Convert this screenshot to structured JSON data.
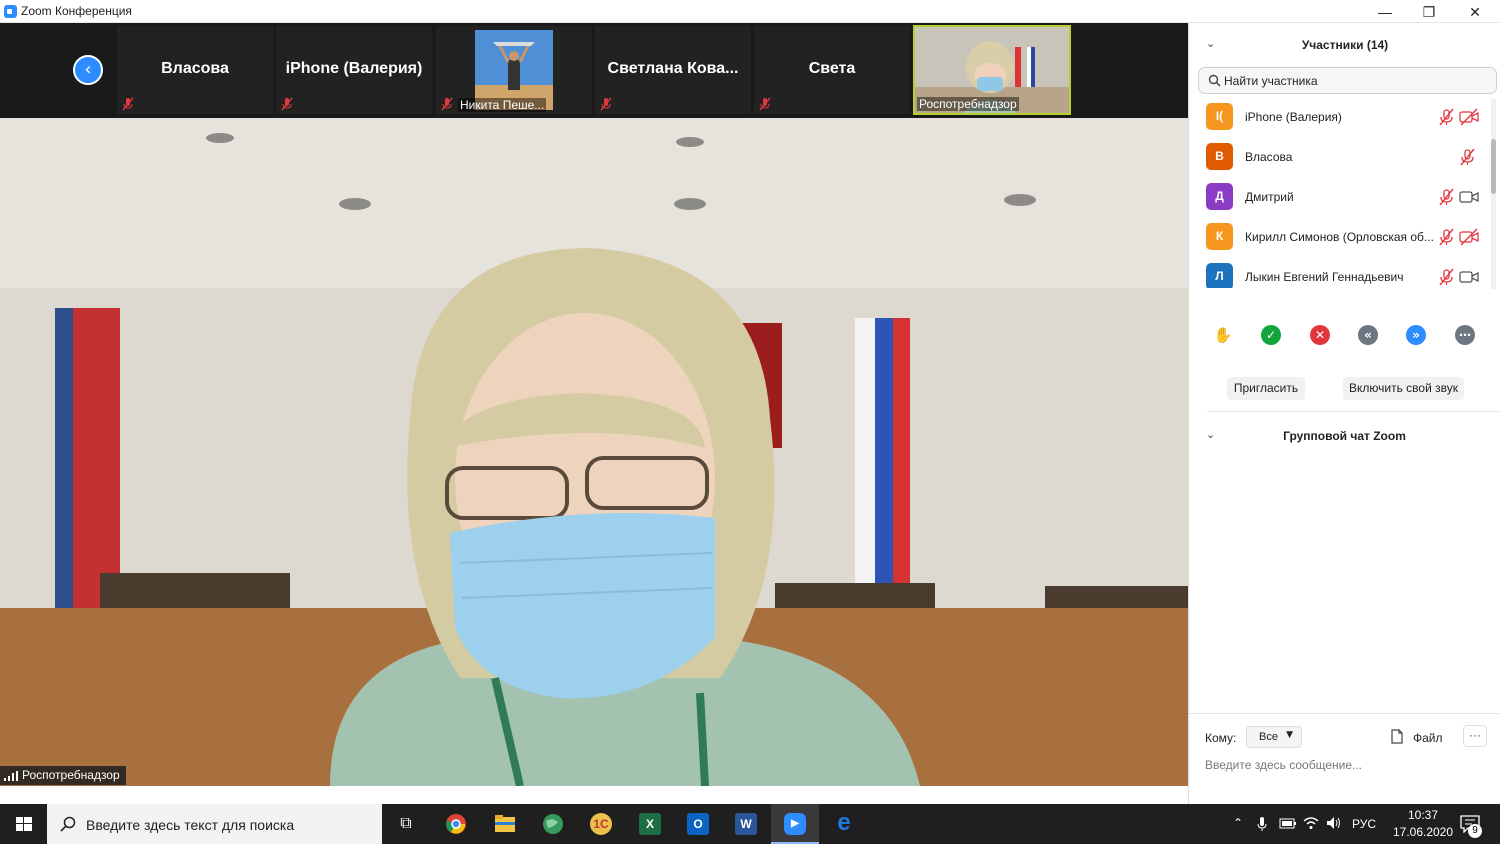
{
  "window": {
    "title": "Zoom Конференция",
    "minimize": "—",
    "maximize": "❐",
    "close": "✕"
  },
  "strip": {
    "back": "‹",
    "tiles": [
      {
        "name": "Власова"
      },
      {
        "name": "iPhone (Валерия)"
      },
      {
        "name": "",
        "sub": "Никита Пеше..."
      },
      {
        "name": "Светлана  Кова..."
      },
      {
        "name": "Света"
      },
      {
        "name": "",
        "sub": "Роспотребнадзор"
      }
    ]
  },
  "main_video": {
    "speaker": "Роспотребнадзор"
  },
  "participants": {
    "title": "Участники (14)",
    "search_placeholder": "Найти участника",
    "list": [
      {
        "initials": "I(",
        "name": "iPhone (Валерия)",
        "color": "#f7961e",
        "mic": "muted",
        "cam": "off"
      },
      {
        "initials": "В",
        "name": "Власова",
        "color": "#e05a00",
        "mic": "muted",
        "cam": "none"
      },
      {
        "initials": "Д",
        "name": "Дмитрий",
        "color": "#8c3cc4",
        "mic": "muted",
        "cam": "on"
      },
      {
        "initials": "К",
        "name": "Кирилл Симонов (Орловская об...",
        "color": "#f7961e",
        "mic": "muted",
        "cam": "off"
      },
      {
        "initials": "Л",
        "name": "Лыкин Евгений Геннадьевич",
        "color": "#1e73be",
        "mic": "muted",
        "cam": "on"
      }
    ],
    "reactions": [
      {
        "icon": "raise-hand-icon",
        "glyph": "✋",
        "color": "#2d8cff"
      },
      {
        "icon": "yes-icon",
        "glyph": "✓",
        "color": "#12a53b"
      },
      {
        "icon": "no-icon",
        "glyph": "✕",
        "color": "#e0383e"
      },
      {
        "icon": "go-slower-icon",
        "glyph": "«",
        "color": "#6d7680"
      },
      {
        "icon": "go-faster-icon",
        "glyph": "»",
        "color": "#2d8cff"
      },
      {
        "icon": "more-icon",
        "glyph": "⋯",
        "color": "#6d7680"
      }
    ],
    "invite": "Пригласить",
    "unmute": "Включить свой звук"
  },
  "chat": {
    "title": "Групповой чат Zoom",
    "to_label": "Кому:",
    "to_value": "Все",
    "file_label": "Файл",
    "more": "···",
    "input_placeholder": "Введите здесь сообщение..."
  },
  "taskbar": {
    "search_placeholder": "Введите здесь текст для поиска",
    "apps": [
      {
        "name": "task-view",
        "glyph": "⧉",
        "color": "transparent"
      },
      {
        "name": "chrome",
        "glyph": "",
        "color": "#db4437"
      },
      {
        "name": "file-explorer",
        "glyph": "",
        "color": "#f4c542"
      },
      {
        "name": "globe-app",
        "glyph": "",
        "color": "#3a9a5b"
      },
      {
        "name": "1c",
        "glyph": "1С",
        "color": "#e8c24a"
      },
      {
        "name": "excel",
        "glyph": "X",
        "color": "#1d6f42"
      },
      {
        "name": "outlook",
        "glyph": "O",
        "color": "#0a64c2"
      },
      {
        "name": "word",
        "glyph": "W",
        "color": "#2b579a"
      },
      {
        "name": "zoom",
        "glyph": "▶",
        "color": "#2d8cff"
      },
      {
        "name": "edge",
        "glyph": "e",
        "color": "#1f7ae0"
      }
    ],
    "language": "РУС",
    "time": "10:37",
    "date": "17.06.2020",
    "notifications": "9"
  }
}
